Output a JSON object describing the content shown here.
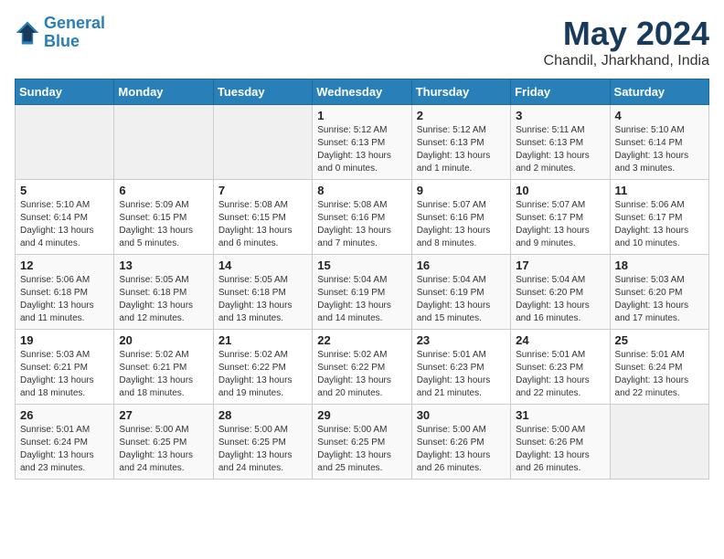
{
  "logo": {
    "line1": "General",
    "line2": "Blue"
  },
  "title": "May 2024",
  "subtitle": "Chandil, Jharkhand, India",
  "weekdays": [
    "Sunday",
    "Monday",
    "Tuesday",
    "Wednesday",
    "Thursday",
    "Friday",
    "Saturday"
  ],
  "weeks": [
    [
      {
        "day": "",
        "sunrise": "",
        "sunset": "",
        "daylight": ""
      },
      {
        "day": "",
        "sunrise": "",
        "sunset": "",
        "daylight": ""
      },
      {
        "day": "",
        "sunrise": "",
        "sunset": "",
        "daylight": ""
      },
      {
        "day": "1",
        "sunrise": "Sunrise: 5:12 AM",
        "sunset": "Sunset: 6:13 PM",
        "daylight": "Daylight: 13 hours and 0 minutes."
      },
      {
        "day": "2",
        "sunrise": "Sunrise: 5:12 AM",
        "sunset": "Sunset: 6:13 PM",
        "daylight": "Daylight: 13 hours and 1 minute."
      },
      {
        "day": "3",
        "sunrise": "Sunrise: 5:11 AM",
        "sunset": "Sunset: 6:13 PM",
        "daylight": "Daylight: 13 hours and 2 minutes."
      },
      {
        "day": "4",
        "sunrise": "Sunrise: 5:10 AM",
        "sunset": "Sunset: 6:14 PM",
        "daylight": "Daylight: 13 hours and 3 minutes."
      }
    ],
    [
      {
        "day": "5",
        "sunrise": "Sunrise: 5:10 AM",
        "sunset": "Sunset: 6:14 PM",
        "daylight": "Daylight: 13 hours and 4 minutes."
      },
      {
        "day": "6",
        "sunrise": "Sunrise: 5:09 AM",
        "sunset": "Sunset: 6:15 PM",
        "daylight": "Daylight: 13 hours and 5 minutes."
      },
      {
        "day": "7",
        "sunrise": "Sunrise: 5:08 AM",
        "sunset": "Sunset: 6:15 PM",
        "daylight": "Daylight: 13 hours and 6 minutes."
      },
      {
        "day": "8",
        "sunrise": "Sunrise: 5:08 AM",
        "sunset": "Sunset: 6:16 PM",
        "daylight": "Daylight: 13 hours and 7 minutes."
      },
      {
        "day": "9",
        "sunrise": "Sunrise: 5:07 AM",
        "sunset": "Sunset: 6:16 PM",
        "daylight": "Daylight: 13 hours and 8 minutes."
      },
      {
        "day": "10",
        "sunrise": "Sunrise: 5:07 AM",
        "sunset": "Sunset: 6:17 PM",
        "daylight": "Daylight: 13 hours and 9 minutes."
      },
      {
        "day": "11",
        "sunrise": "Sunrise: 5:06 AM",
        "sunset": "Sunset: 6:17 PM",
        "daylight": "Daylight: 13 hours and 10 minutes."
      }
    ],
    [
      {
        "day": "12",
        "sunrise": "Sunrise: 5:06 AM",
        "sunset": "Sunset: 6:18 PM",
        "daylight": "Daylight: 13 hours and 11 minutes."
      },
      {
        "day": "13",
        "sunrise": "Sunrise: 5:05 AM",
        "sunset": "Sunset: 6:18 PM",
        "daylight": "Daylight: 13 hours and 12 minutes."
      },
      {
        "day": "14",
        "sunrise": "Sunrise: 5:05 AM",
        "sunset": "Sunset: 6:18 PM",
        "daylight": "Daylight: 13 hours and 13 minutes."
      },
      {
        "day": "15",
        "sunrise": "Sunrise: 5:04 AM",
        "sunset": "Sunset: 6:19 PM",
        "daylight": "Daylight: 13 hours and 14 minutes."
      },
      {
        "day": "16",
        "sunrise": "Sunrise: 5:04 AM",
        "sunset": "Sunset: 6:19 PM",
        "daylight": "Daylight: 13 hours and 15 minutes."
      },
      {
        "day": "17",
        "sunrise": "Sunrise: 5:04 AM",
        "sunset": "Sunset: 6:20 PM",
        "daylight": "Daylight: 13 hours and 16 minutes."
      },
      {
        "day": "18",
        "sunrise": "Sunrise: 5:03 AM",
        "sunset": "Sunset: 6:20 PM",
        "daylight": "Daylight: 13 hours and 17 minutes."
      }
    ],
    [
      {
        "day": "19",
        "sunrise": "Sunrise: 5:03 AM",
        "sunset": "Sunset: 6:21 PM",
        "daylight": "Daylight: 13 hours and 18 minutes."
      },
      {
        "day": "20",
        "sunrise": "Sunrise: 5:02 AM",
        "sunset": "Sunset: 6:21 PM",
        "daylight": "Daylight: 13 hours and 18 minutes."
      },
      {
        "day": "21",
        "sunrise": "Sunrise: 5:02 AM",
        "sunset": "Sunset: 6:22 PM",
        "daylight": "Daylight: 13 hours and 19 minutes."
      },
      {
        "day": "22",
        "sunrise": "Sunrise: 5:02 AM",
        "sunset": "Sunset: 6:22 PM",
        "daylight": "Daylight: 13 hours and 20 minutes."
      },
      {
        "day": "23",
        "sunrise": "Sunrise: 5:01 AM",
        "sunset": "Sunset: 6:23 PM",
        "daylight": "Daylight: 13 hours and 21 minutes."
      },
      {
        "day": "24",
        "sunrise": "Sunrise: 5:01 AM",
        "sunset": "Sunset: 6:23 PM",
        "daylight": "Daylight: 13 hours and 22 minutes."
      },
      {
        "day": "25",
        "sunrise": "Sunrise: 5:01 AM",
        "sunset": "Sunset: 6:24 PM",
        "daylight": "Daylight: 13 hours and 22 minutes."
      }
    ],
    [
      {
        "day": "26",
        "sunrise": "Sunrise: 5:01 AM",
        "sunset": "Sunset: 6:24 PM",
        "daylight": "Daylight: 13 hours and 23 minutes."
      },
      {
        "day": "27",
        "sunrise": "Sunrise: 5:00 AM",
        "sunset": "Sunset: 6:25 PM",
        "daylight": "Daylight: 13 hours and 24 minutes."
      },
      {
        "day": "28",
        "sunrise": "Sunrise: 5:00 AM",
        "sunset": "Sunset: 6:25 PM",
        "daylight": "Daylight: 13 hours and 24 minutes."
      },
      {
        "day": "29",
        "sunrise": "Sunrise: 5:00 AM",
        "sunset": "Sunset: 6:25 PM",
        "daylight": "Daylight: 13 hours and 25 minutes."
      },
      {
        "day": "30",
        "sunrise": "Sunrise: 5:00 AM",
        "sunset": "Sunset: 6:26 PM",
        "daylight": "Daylight: 13 hours and 26 minutes."
      },
      {
        "day": "31",
        "sunrise": "Sunrise: 5:00 AM",
        "sunset": "Sunset: 6:26 PM",
        "daylight": "Daylight: 13 hours and 26 minutes."
      },
      {
        "day": "",
        "sunrise": "",
        "sunset": "",
        "daylight": ""
      }
    ]
  ]
}
